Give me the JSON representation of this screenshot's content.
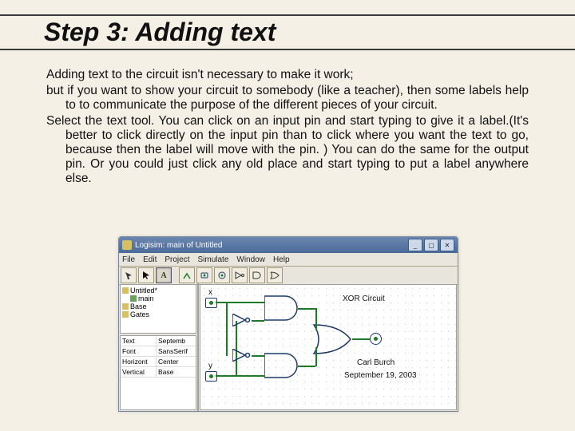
{
  "title": "Step 3: Adding text",
  "paragraphs": {
    "p1": "Adding text to the circuit isn't necessary to make it work;",
    "p2": "but if you want to show your circuit to somebody (like a teacher), then some labels help to to communicate the purpose of the different pieces of your circuit.",
    "p3": "Select the text tool. You can click on an input pin and start typing to give it a label.(It's better to click directly on the input pin than to click where you want the text to go, because then the label will move with the pin. ) You can do the same for the output pin. Or you could just click any old place and start typing to put a label anywhere else."
  },
  "app": {
    "window_title": "Logisim: main of Untitled",
    "menus": [
      "File",
      "Edit",
      "Project",
      "Simulate",
      "Window",
      "Help"
    ],
    "toolbar_icons": [
      "poke",
      "select",
      "text",
      "wire",
      "input-pin",
      "output-pin",
      "not-gate",
      "and-gate",
      "or-gate"
    ],
    "tree": {
      "root": "Untitled*",
      "items": [
        "main",
        "Base",
        "Gates"
      ]
    },
    "props": [
      {
        "k": "Text",
        "v": "Septemb"
      },
      {
        "k": "Font",
        "v": "SansSerif"
      },
      {
        "k": "Horizont",
        "v": "Center"
      },
      {
        "k": "Vertical",
        "v": "Base"
      }
    ],
    "canvas": {
      "label_top": "XOR Circuit",
      "label_mid": "Carl Burch",
      "label_date": "September 19, 2003",
      "input_x": "x",
      "input_y": "y",
      "pin_value": "0"
    }
  }
}
